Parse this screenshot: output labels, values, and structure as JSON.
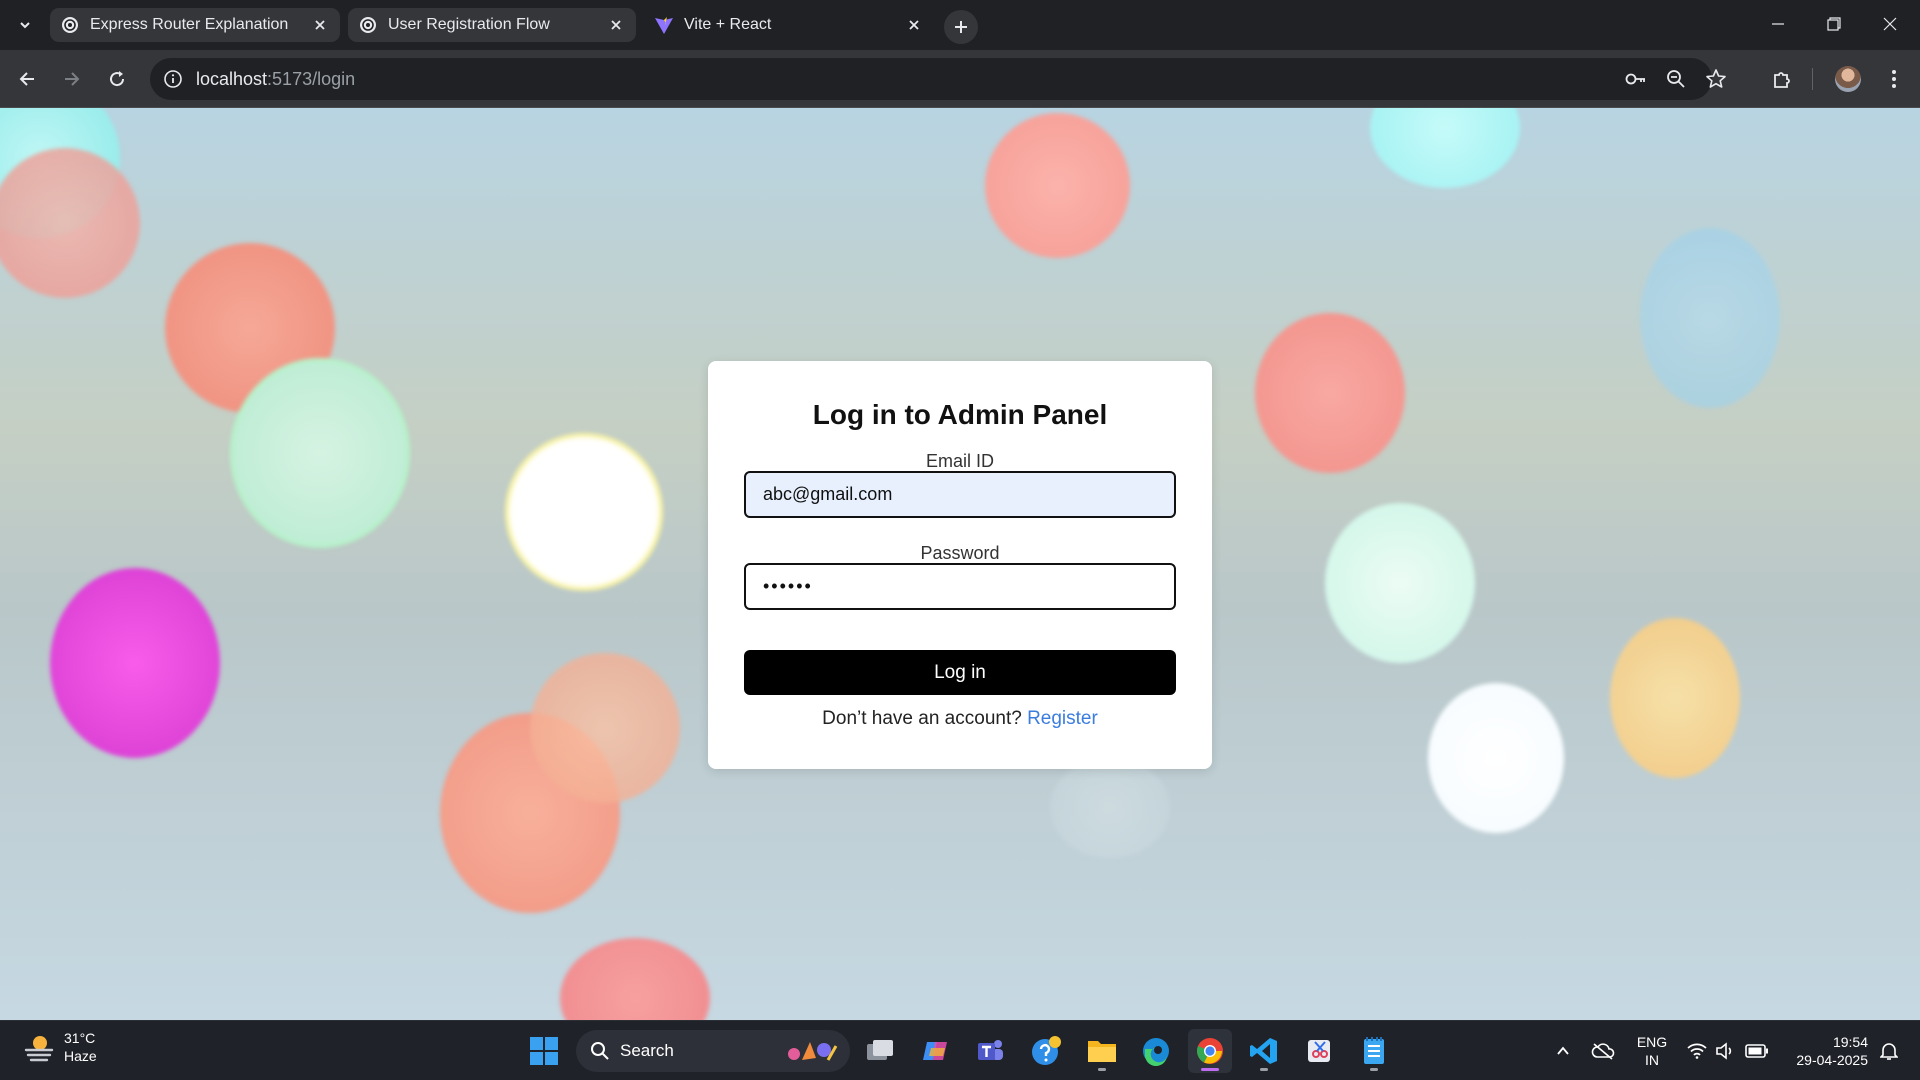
{
  "browser": {
    "tabs": [
      {
        "title": "Express Router Explanation",
        "favicon": "chatgpt-icon",
        "active": false
      },
      {
        "title": "User Registration Flow",
        "favicon": "chatgpt-icon",
        "active": false
      },
      {
        "title": "Vite + React",
        "favicon": "vite-icon",
        "active": true
      }
    ],
    "address": {
      "host": "localhost",
      "path": ":5173/login"
    }
  },
  "page": {
    "title": "Log in to Admin Panel",
    "email_label": "Email ID",
    "email_value": "abc@gmail.com",
    "password_label": "Password",
    "password_value": "••••••",
    "login_button": "Log in",
    "register_prompt": "Don’t have an account?",
    "register_link": "Register"
  },
  "taskbar": {
    "weather_temp": "31°C",
    "weather_desc": "Haze",
    "search_label": "Search",
    "lang_line1": "ENG",
    "lang_line2": "IN",
    "time": "19:54",
    "date": "29-04-2025"
  },
  "colors": {
    "accent_link": "#3b7ddd",
    "button": "#000000",
    "browser_chrome": "#202124"
  }
}
